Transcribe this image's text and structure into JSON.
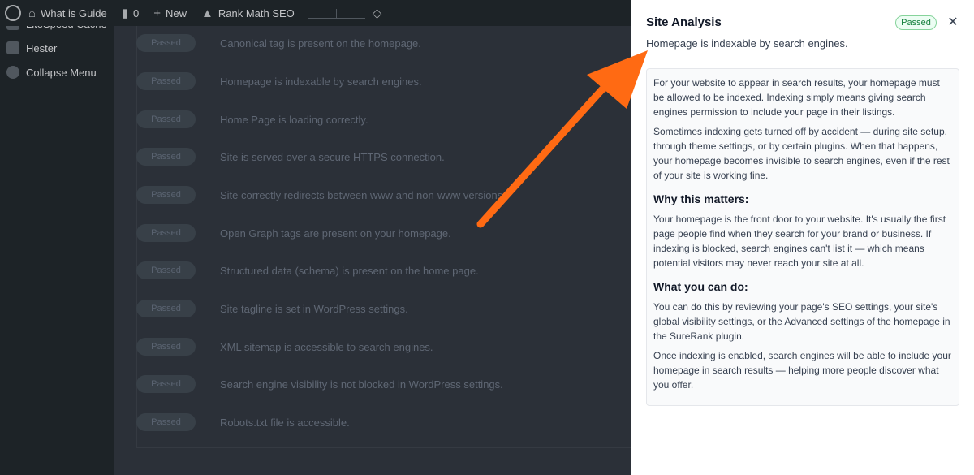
{
  "admin_bar": {
    "site_name": "What is Guide",
    "comments_count": "0",
    "new_label": "New",
    "rank_math_label": "Rank Math SEO"
  },
  "sidebar": {
    "items": [
      {
        "label": "LiteSpeed Cache",
        "icon": "litespeed-icon"
      },
      {
        "label": "Hester",
        "icon": "hester-icon"
      },
      {
        "label": "Collapse Menu",
        "icon": "collapse-icon"
      }
    ]
  },
  "checks": [
    {
      "status": "Passed",
      "text": "Canonical tag is present on the homepage."
    },
    {
      "status": "Passed",
      "text": "Homepage is indexable by search engines."
    },
    {
      "status": "Passed",
      "text": "Home Page is loading correctly."
    },
    {
      "status": "Passed",
      "text": "Site is served over a secure HTTPS connection."
    },
    {
      "status": "Passed",
      "text": "Site correctly redirects between www and non-www versions."
    },
    {
      "status": "Passed",
      "text": "Open Graph tags are present on your homepage."
    },
    {
      "status": "Passed",
      "text": "Structured data (schema) is present on the home page."
    },
    {
      "status": "Passed",
      "text": "Site tagline is set in WordPress settings."
    },
    {
      "status": "Passed",
      "text": "XML sitemap is accessible to search engines."
    },
    {
      "status": "Passed",
      "text": "Search engine visibility is not blocked in WordPress settings."
    },
    {
      "status": "Passed",
      "text": "Robots.txt file is accessible."
    }
  ],
  "drawer": {
    "title": "Site Analysis",
    "badge": "Passed",
    "close_icon": "close-icon",
    "subtitle": "Homepage is indexable by search engines.",
    "paragraphs_intro": [
      "For your website to appear in search results, your homepage must be allowed to be indexed. Indexing simply means giving search engines permission to include your page in their listings.",
      "Sometimes indexing gets turned off by accident — during site setup, through theme settings, or by certain plugins. When that happens, your homepage becomes invisible to search engines, even if the rest of your site is working fine."
    ],
    "why_heading": "Why this matters:",
    "why_text": "Your homepage is the front door to your website. It's usually the first page people find when they search for your brand or business. If indexing is blocked, search engines can't list it — which means potential visitors may never reach your site at all.",
    "what_heading": "What you can do:",
    "what_paragraphs": [
      "You can do this by reviewing your page's SEO settings, your site's global visibility settings, or the Advanced settings of the homepage in the SureRank plugin.",
      "Once indexing is enabled, search engines will be able to include your homepage in search results — helping more people discover what you offer."
    ]
  },
  "colors": {
    "accent_arrow": "#ff6a13",
    "badge_green": "#15803d"
  }
}
